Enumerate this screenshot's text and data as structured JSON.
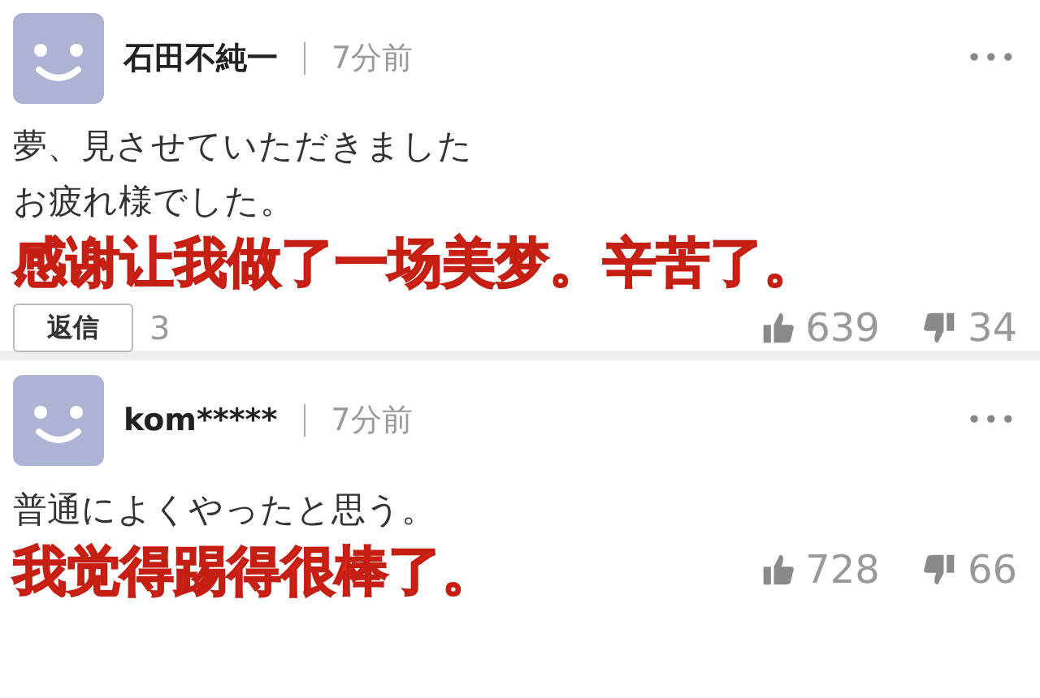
{
  "comments": [
    {
      "author": "石田不純一",
      "time": "7分前",
      "menu": "•••",
      "body": [
        "夢、見させていただきました",
        "お疲れ様でした。"
      ],
      "subtitle": "感谢让我做了一场美梦。辛苦了。",
      "reply": {
        "label": "返信",
        "count": "3"
      },
      "likes": "639",
      "dislikes": "34"
    },
    {
      "author": "kom*****",
      "time": "7分前",
      "menu": "•••",
      "body": [
        "普通によくやったと思う。"
      ],
      "subtitle": "我觉得踢得很棒了。",
      "likes": "728",
      "dislikes": "66"
    }
  ]
}
